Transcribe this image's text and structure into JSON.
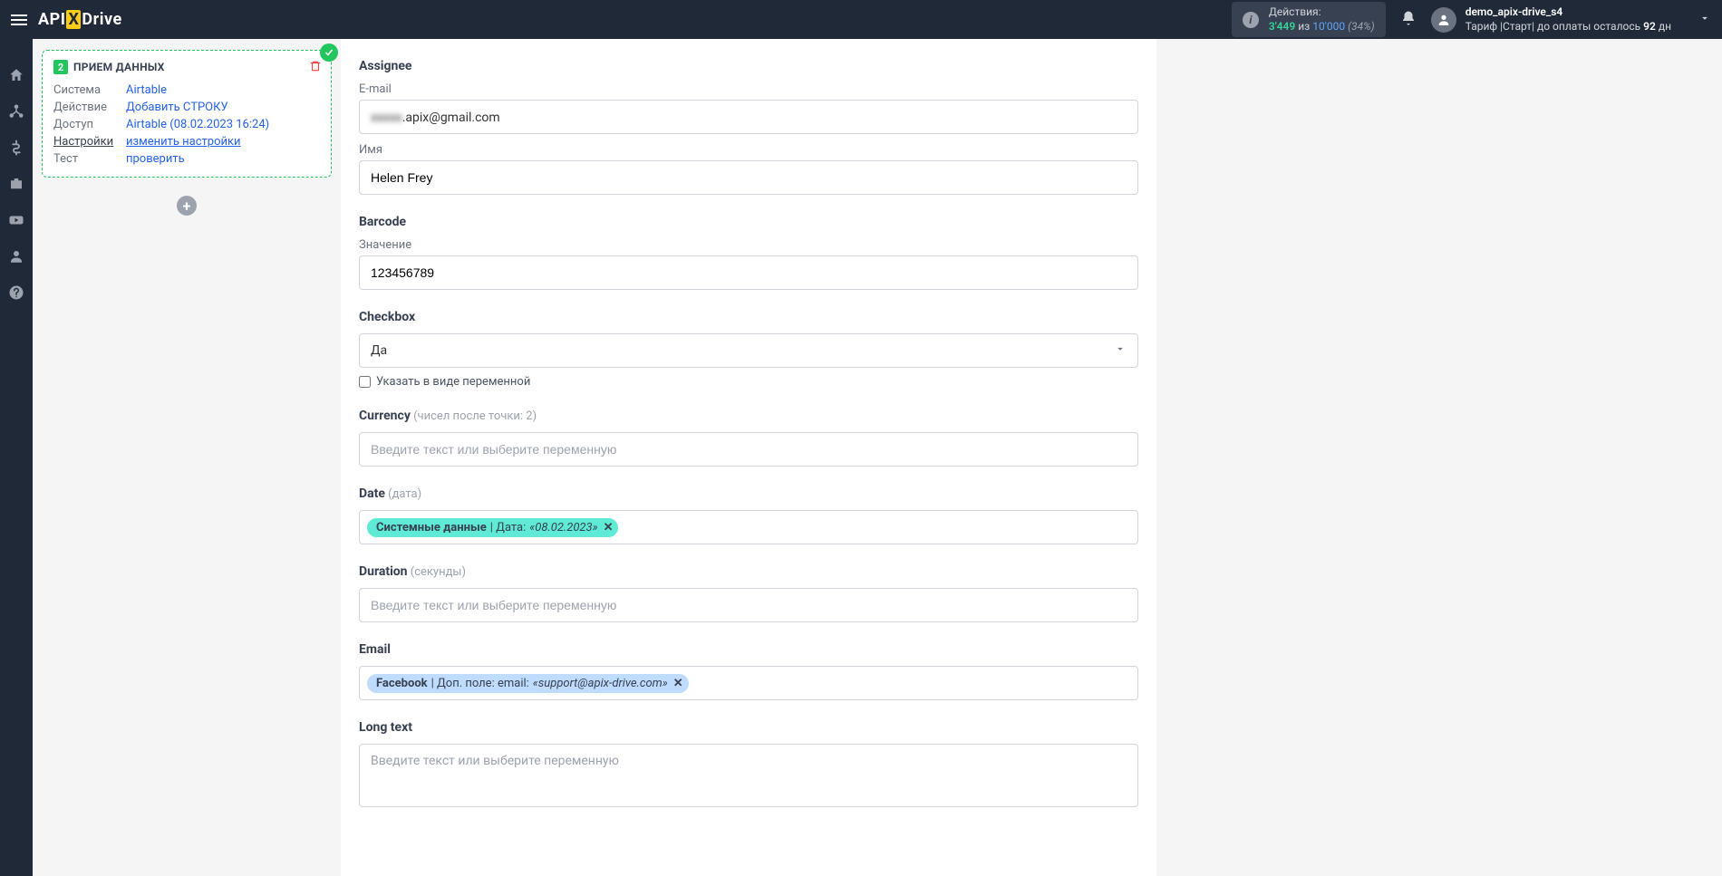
{
  "header": {
    "logo_api": "API",
    "logo_x": "X",
    "logo_drive": "Drive",
    "actions_label": "Действия:",
    "actions_current": "3'449",
    "actions_sep": "из",
    "actions_total": "10'000",
    "actions_pct": "(34%)",
    "user_name": "demo_apix-drive_s4",
    "user_tariff_prefix": "Тариф |Старт| до оплаты осталось ",
    "user_tariff_days": "92",
    "user_tariff_suffix": " дн"
  },
  "card": {
    "badge": "2",
    "title": "ПРИЕМ ДАННЫХ",
    "rows": {
      "system_label": "Система",
      "system_value": "Airtable",
      "action_label": "Действие",
      "action_value": "Добавить СТРОКУ",
      "access_label": "Доступ",
      "access_value": "Airtable (08.02.2023 16:24)",
      "settings_label": "Настройки",
      "settings_value": "изменить настройки",
      "test_label": "Тест",
      "test_value": "проверить"
    }
  },
  "form": {
    "assignee_label": "Assignee",
    "email_sublabel": "E-mail",
    "email_value_blur": "xxxxx",
    "email_value_visible": ".apix@gmail.com",
    "name_sublabel": "Имя",
    "name_value": "Helen Frey",
    "barcode_label": "Barcode",
    "barcode_sublabel": "Значение",
    "barcode_value": "123456789",
    "checkbox_label": "Checkbox",
    "checkbox_value": "Да",
    "checkbox_variable": "Указать в виде переменной",
    "currency_label": "Currency",
    "currency_hint": " (чисел после точки: 2)",
    "currency_placeholder": "Введите текст или выберите переменную",
    "date_label": "Date",
    "date_hint": " (дата)",
    "date_chip_source": "Системные данные",
    "date_chip_sep": " | Дата: ",
    "date_chip_value": "«08.02.2023»",
    "duration_label": "Duration",
    "duration_hint": " (секунды)",
    "duration_placeholder": "Введите текст или выберите переменную",
    "email2_label": "Email",
    "email2_chip_source": "Facebook",
    "email2_chip_sep": " | Доп. поле: email: ",
    "email2_chip_value": "«support@apix-drive.com»",
    "longtext_label": "Long text",
    "longtext_placeholder": "Введите текст или выберите переменную",
    "chip_close": "✕"
  }
}
